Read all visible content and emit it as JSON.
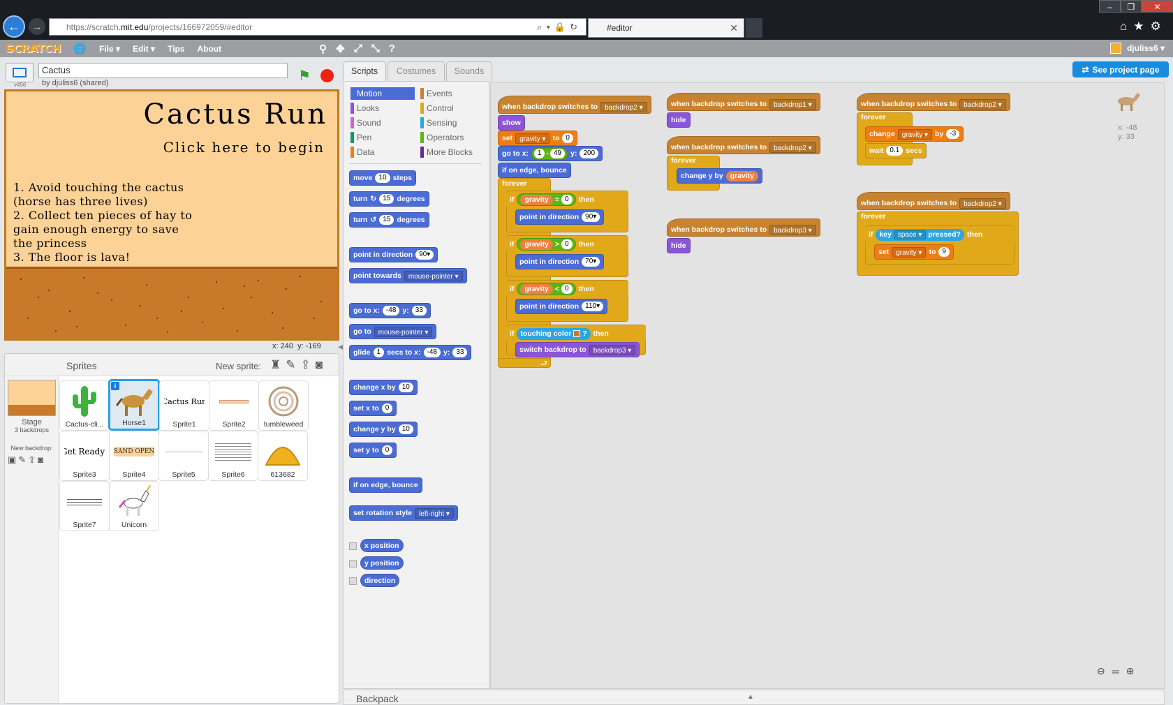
{
  "browser": {
    "url_prefix": "https://scratch.",
    "url_domain": "mit.edu",
    "url_path": "/projects/166972059/#editor",
    "tab_title": "#editor"
  },
  "menu": {
    "logo": "SCRATCH",
    "file": "File ▾",
    "edit": "Edit ▾",
    "tips": "Tips",
    "about": "About",
    "username": "djuliss6 ▾"
  },
  "project": {
    "version": "v456",
    "title": "Cactus",
    "author": "by djuliss6 (shared)"
  },
  "stage": {
    "title": "Cactus Run",
    "subtitle": "Click here to begin",
    "rules": "1. Avoid touching the cactus\n(horse has three lives)\n2. Collect ten pieces of hay to\ngain enough energy to save\n   the princess\n3. The floor is lava!",
    "mouse_x_label": "x:",
    "mouse_x": "240",
    "mouse_y_label": "y:",
    "mouse_y": "-169"
  },
  "sprites_panel": {
    "label": "Sprites",
    "new_sprite": "New sprite:",
    "stage_name": "Stage",
    "stage_backdrops": "3 backdrops",
    "new_backdrop": "New backdrop:",
    "sprites": [
      {
        "name": "Cactus-cli..."
      },
      {
        "name": "Horse1"
      },
      {
        "name": "Sprite1"
      },
      {
        "name": "Sprite2"
      },
      {
        "name": "tumbleweed"
      },
      {
        "name": "Sprite3"
      },
      {
        "name": "Sprite4"
      },
      {
        "name": "Sprite5"
      },
      {
        "name": "Sprite6"
      },
      {
        "name": "613682"
      },
      {
        "name": "Sprite7"
      },
      {
        "name": "Unicorn"
      }
    ],
    "sprite1_text": "Cactus Run",
    "sprite3_text": "Get Ready!",
    "sprite4_text": "SAND OPEN"
  },
  "tabs": {
    "scripts": "Scripts",
    "costumes": "Costumes",
    "sounds": "Sounds"
  },
  "categories": {
    "motion": "Motion",
    "looks": "Looks",
    "sound": "Sound",
    "pen": "Pen",
    "data": "Data",
    "events": "Events",
    "control": "Control",
    "sensing": "Sensing",
    "operators": "Operators",
    "more": "More Blocks"
  },
  "palette": {
    "move": "move",
    "move_n": "10",
    "steps": "steps",
    "turn": "turn",
    "turn_n": "15",
    "degrees": "degrees",
    "point_dir": "point in direction",
    "point_dir_v": "90▾",
    "point_towards": "point towards",
    "mouse_pointer": "mouse-pointer ▾",
    "goto_x": "go to x:",
    "goto_xv": "-48",
    "y": "y:",
    "goto_yv": "33",
    "goto": "go to",
    "glide": "glide",
    "glide_n": "1",
    "secs_to_x": "secs to x:",
    "change_x": "change x by",
    "change_x_v": "10",
    "set_x": "set x to",
    "set_x_v": "0",
    "change_y": "change y by",
    "change_y_v": "10",
    "set_y": "set y to",
    "set_y_v": "0",
    "edge": "if on edge, bounce",
    "rot": "set rotation style",
    "rot_v": "left-right ▾",
    "xpos": "x position",
    "ypos": "y position",
    "direction": "direction"
  },
  "scripts": {
    "when_backdrop": "when backdrop switches to",
    "backdrop1": "backdrop1 ▾",
    "backdrop2": "backdrop2 ▾",
    "backdrop3": "backdrop3 ▾",
    "show": "show",
    "hide": "hide",
    "set": "set",
    "gravity_dd": "gravity ▾",
    "to": "to",
    "zero": "0",
    "goto_x": "go to x:",
    "one": "1",
    "minus": "-",
    "fortynine": "49",
    "y": "y:",
    "twohundred": "200",
    "edge": "if on edge, bounce",
    "forever": "forever",
    "if": "if",
    "then": "then",
    "gravity": "gravity",
    "eq": "=",
    "gt": ">",
    "lt": "<",
    "point_dir": "point in direction",
    "d90": "90▾",
    "d70": "70▾",
    "d110": "110▾",
    "touching_color": "touching color",
    "q": "?",
    "switch_backdrop": "switch backdrop to",
    "change_y_by": "change y by",
    "change": "change",
    "by": "by",
    "neg3": "-3",
    "wait": "wait",
    "wait_v": "0.1",
    "secs": "secs",
    "key": "key",
    "space": "space ▾",
    "pressed": "pressed?",
    "nine": "9"
  },
  "workspace": {
    "see_project": "See project page",
    "sprite_x": "x: -48",
    "sprite_y": "y: 33"
  },
  "backpack": {
    "label": "Backpack"
  },
  "colors": {
    "motion": "#4a6cd4",
    "looks": "#8a55d7",
    "events": "#c88330",
    "control": "#e1a91a",
    "data": "#ee7d16",
    "sensing": "#2ca5e2",
    "operators": "#5cb712"
  }
}
